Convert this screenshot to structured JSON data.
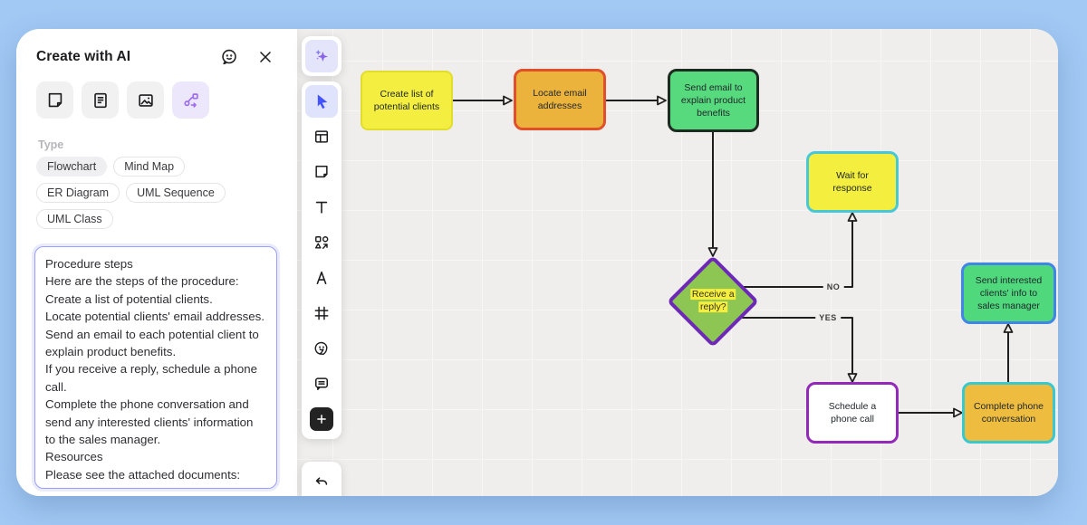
{
  "panel": {
    "title": "Create with AI",
    "type_label": "Type",
    "type_options": [
      {
        "label": "Flowchart",
        "selected": true
      },
      {
        "label": "Mind Map",
        "selected": false
      },
      {
        "label": "ER Diagram",
        "selected": false
      },
      {
        "label": "UML Sequence",
        "selected": false
      },
      {
        "label": "UML Class",
        "selected": false
      }
    ],
    "mode_buttons": [
      {
        "icon": "sticky-note-icon",
        "selected": false
      },
      {
        "icon": "document-icon",
        "selected": false
      },
      {
        "icon": "image-icon",
        "selected": false
      },
      {
        "icon": "diagram-icon",
        "selected": true
      }
    ],
    "header_icons": [
      "feedback-smiley-icon",
      "close-icon"
    ],
    "prompt": {
      "value": "Procedure steps\nHere are the steps of the procedure:\nCreate a list of potential clients.\nLocate potential clients' email addresses.\nSend an email to each potential client to explain product benefits.\nIf you receive a reply, schedule a phone call.\nComplete the phone conversation and send any interested clients' information to the sales manager.\nResources\nPlease see the attached documents:"
    }
  },
  "toolbar": {
    "tools": [
      "ai-sparkles",
      "select-cursor",
      "templates",
      "sticky-note",
      "text",
      "shapes",
      "pen",
      "frame",
      "sticker",
      "comment",
      "add-more",
      "undo"
    ],
    "selected_tool": "select-cursor"
  },
  "flowchart": {
    "nodes": [
      {
        "id": "create-list",
        "label": "Create list of potential clients",
        "shape": "rect",
        "fill": "#f3ee3f",
        "border": "#e2dd2c"
      },
      {
        "id": "locate-email",
        "label": "Locate email addresses",
        "shape": "rect",
        "fill": "#ecb33c",
        "border": "#e0512b"
      },
      {
        "id": "send-email",
        "label": "Send email to explain product benefits",
        "shape": "rect",
        "fill": "#57d97d",
        "border": "#1d2b20"
      },
      {
        "id": "wait-response",
        "label": "Wait for response",
        "shape": "rect",
        "fill": "#f4ee3f",
        "border": "#46c8d9"
      },
      {
        "id": "receive-reply",
        "label": "Receive a reply?",
        "shape": "diamond",
        "fill": "#8dc653",
        "border": "#6d28b8",
        "highlight": "#f6ee3e"
      },
      {
        "id": "send-info",
        "label": "Send interested clients' info to sales manager",
        "shape": "rect",
        "fill": "#50d87d",
        "border": "#4285e8"
      },
      {
        "id": "schedule-call",
        "label": "Schedule a phone call",
        "shape": "rect",
        "fill": "#ffffff",
        "border": "#9229b8"
      },
      {
        "id": "complete-conversation",
        "label": "Complete phone conversation",
        "shape": "rect",
        "fill": "#eebc3e",
        "border": "#38c8cf"
      }
    ],
    "edges": [
      {
        "from": "create-list",
        "to": "locate-email",
        "label": ""
      },
      {
        "from": "locate-email",
        "to": "send-email",
        "label": ""
      },
      {
        "from": "send-email",
        "to": "receive-reply",
        "label": ""
      },
      {
        "from": "receive-reply",
        "to": "wait-response",
        "label": "NO"
      },
      {
        "from": "receive-reply",
        "to": "schedule-call",
        "label": "YES"
      },
      {
        "from": "schedule-call",
        "to": "complete-conversation",
        "label": ""
      },
      {
        "from": "complete-conversation",
        "to": "send-info",
        "label": ""
      }
    ]
  },
  "colors": {
    "page_background": "#a2c9f4",
    "canvas_background": "#efeeec",
    "accent_purple": "#9d6ef0",
    "cursor_blue": "#4253ff",
    "prompt_border": "#99a0f7"
  }
}
